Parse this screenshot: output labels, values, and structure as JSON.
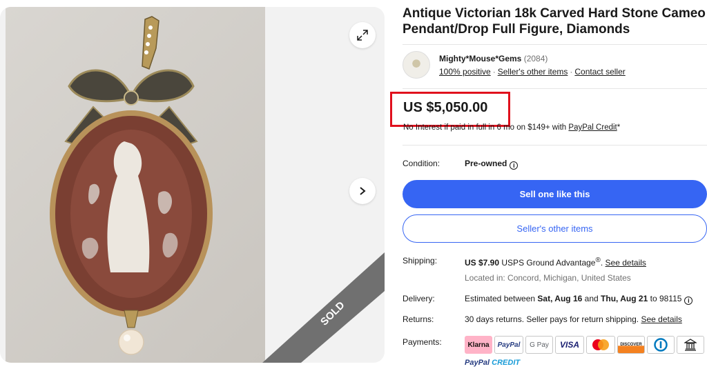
{
  "listing": {
    "title": "Antique Victorian 18k Carved Hard Stone Cameo Pendant/Drop Full Figure, Diamonds",
    "sold_badge": "SOLD"
  },
  "seller": {
    "name": "Mighty*Mouse*Gems",
    "feedback_count": "(2084)",
    "positive": "100% positive",
    "other_items_link": "Seller's other items",
    "contact_link": "Contact seller"
  },
  "price": {
    "amount": "US $5,050.00",
    "financing_text": "No Interest if paid in full in 6 mo on $149+ with",
    "financing_link": "PayPal Credit",
    "financing_suffix": "*"
  },
  "condition": {
    "label": "Condition:",
    "value": "Pre-owned"
  },
  "buttons": {
    "sell_label": "Sell one like this",
    "other_items_label": "Seller's other items"
  },
  "shipping": {
    "label": "Shipping:",
    "cost": "US $7.90",
    "service": "USPS Ground Advantage",
    "reg": "®",
    "dot": ".",
    "details_link": "See details",
    "location": "Located in: Concord, Michigan, United States"
  },
  "delivery": {
    "label": "Delivery:",
    "prefix": "Estimated between",
    "start": "Sat, Aug 16",
    "and": "and",
    "end": "Thu, Aug 21",
    "to": "to 98115"
  },
  "returns": {
    "label": "Returns:",
    "text": "30 days returns. Seller pays for return shipping.",
    "details_link": "See details"
  },
  "payments": {
    "label": "Payments:",
    "methods": [
      "Klarna",
      "PayPal",
      "G Pay",
      "VISA",
      "Mastercard",
      "DISCOVER",
      "Diners Club",
      "Bank"
    ],
    "paypal_credit_a": "PayPal",
    "paypal_credit_b": "CREDIT"
  },
  "colors": {
    "accent": "#3665f3",
    "highlight": "#e0101d",
    "klarna": "#ffb3c7"
  }
}
